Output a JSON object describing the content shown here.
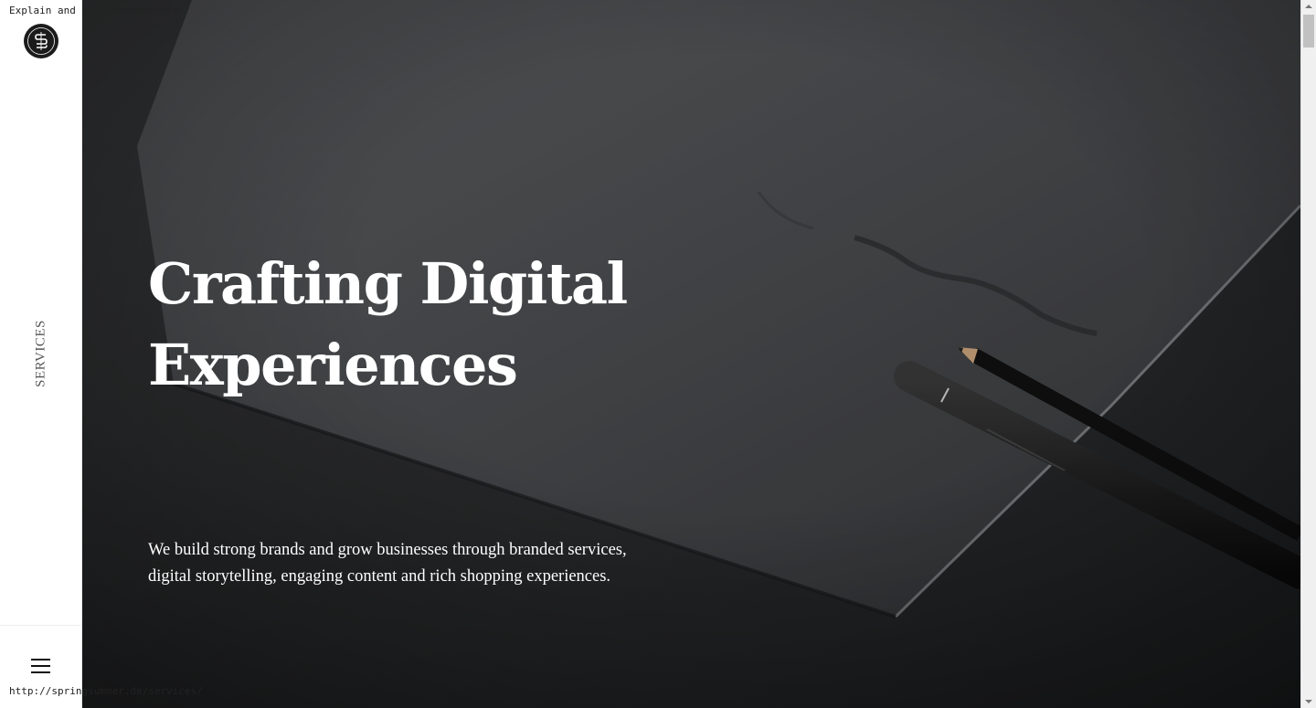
{
  "overlay": {
    "tool_label": "Explain and Send Screenshots"
  },
  "sidebar": {
    "logo_icon": "springsummer-monogram-logo",
    "vertical_label": "SERVICES",
    "menu_icon": "hamburger-menu-icon"
  },
  "hero": {
    "title_line1": "Crafting Digital",
    "title_line2": "Experiences",
    "description_line1": "We build strong brands and grow businesses through branded services,",
    "description_line2": "digital storytelling, engaging content and rich shopping experiences."
  },
  "status_bar": {
    "url": "http://springsummer.dk/services/"
  },
  "colors": {
    "hero_background": "#2b2d2f",
    "hero_text": "#ffffff",
    "sidebar_background": "#ffffff",
    "logo_background": "#1b1b1b"
  }
}
